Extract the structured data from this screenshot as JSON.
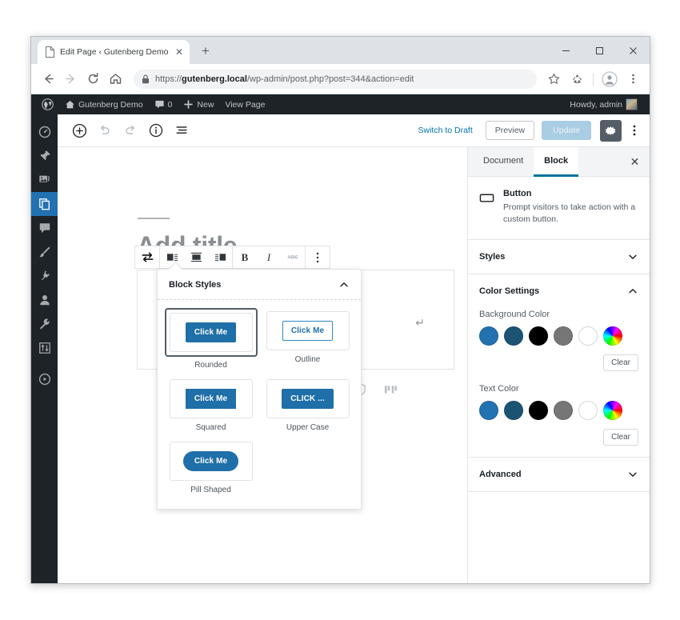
{
  "browser": {
    "tab": {
      "title": "Edit Page ‹ Gutenberg Demo — \\",
      "close_label": "✕"
    },
    "new_tab_label": "+",
    "window_controls": {
      "minimize": "–",
      "maximize": "▢",
      "close": "✕"
    },
    "url_prefix": "https://",
    "url_domain": "gutenberg.local",
    "url_path": "/wp-admin/post.php?post=344&action=edit"
  },
  "wp_adminbar": {
    "site_name": "Gutenberg Demo",
    "comment_count": "0",
    "new_label": "New",
    "view_page_label": "View Page",
    "howdy": "Howdy, admin"
  },
  "wp_rail": {
    "items": [
      {
        "name": "dashboard",
        "active": false
      },
      {
        "name": "posts",
        "active": false
      },
      {
        "name": "media",
        "active": false
      },
      {
        "name": "pages",
        "active": true
      },
      {
        "name": "comments",
        "active": false
      },
      {
        "name": "appearance",
        "active": false
      },
      {
        "name": "plugins",
        "active": false
      },
      {
        "name": "users",
        "active": false
      },
      {
        "name": "tools",
        "active": false
      },
      {
        "name": "settings",
        "active": false
      },
      {
        "name": "collapse",
        "active": false
      }
    ]
  },
  "editor_header": {
    "switch_to_draft": "Switch to Draft",
    "preview": "Preview",
    "update": "Update"
  },
  "canvas": {
    "title_placeholder": "Add title"
  },
  "block_toolbar": {
    "buttons": [
      "transform-block",
      "align-left",
      "align-center",
      "align-right",
      "bold",
      "italic",
      "strikethrough",
      "more-options"
    ],
    "bold_label": "B",
    "italic_label": "I",
    "strike_label": "ABC"
  },
  "block_styles_popover": {
    "title": "Block Styles",
    "collapse_icon": "chevron-up",
    "styles": [
      {
        "label": "Rounded",
        "button_text": "Click Me",
        "variant": "rounded",
        "selected": true
      },
      {
        "label": "Outline",
        "button_text": "Click Me",
        "variant": "outline",
        "selected": false
      },
      {
        "label": "Squared",
        "button_text": "Click Me",
        "variant": "squared",
        "selected": false
      },
      {
        "label": "Upper Case",
        "button_text": "CLICK ...",
        "variant": "rounded",
        "selected": false
      },
      {
        "label": "Pill Shaped",
        "button_text": "Click Me",
        "variant": "pill",
        "selected": false
      }
    ]
  },
  "inspector": {
    "tabs": [
      {
        "label": "Document",
        "active": false
      },
      {
        "label": "Block",
        "active": true
      }
    ],
    "close_label": "✕",
    "block_card": {
      "title": "Button",
      "description": "Prompt visitors to take action with a custom button."
    },
    "panels": [
      {
        "title": "Styles",
        "expanded": false,
        "chevron": "chevron-down"
      },
      {
        "title": "Color Settings",
        "expanded": true,
        "chevron": "chevron-up"
      },
      {
        "title": "Advanced",
        "expanded": false,
        "chevron": "chevron-down"
      }
    ],
    "color_settings": {
      "background": {
        "label": "Background Color",
        "swatches": [
          "#2271b1",
          "#1b5373",
          "#000000",
          "#767676",
          "#ffffff",
          "rainbow"
        ],
        "clear_label": "Clear"
      },
      "text": {
        "label": "Text Color",
        "swatches": [
          "#2271b1",
          "#1b5373",
          "#000000",
          "#767676",
          "#ffffff",
          "rainbow"
        ],
        "clear_label": "Clear"
      }
    }
  },
  "colors": {
    "accent_blue": "#1f6fa8",
    "wp_blue": "#2271b1",
    "admin_dark": "#1d2327",
    "link_blue": "#0073aa"
  }
}
